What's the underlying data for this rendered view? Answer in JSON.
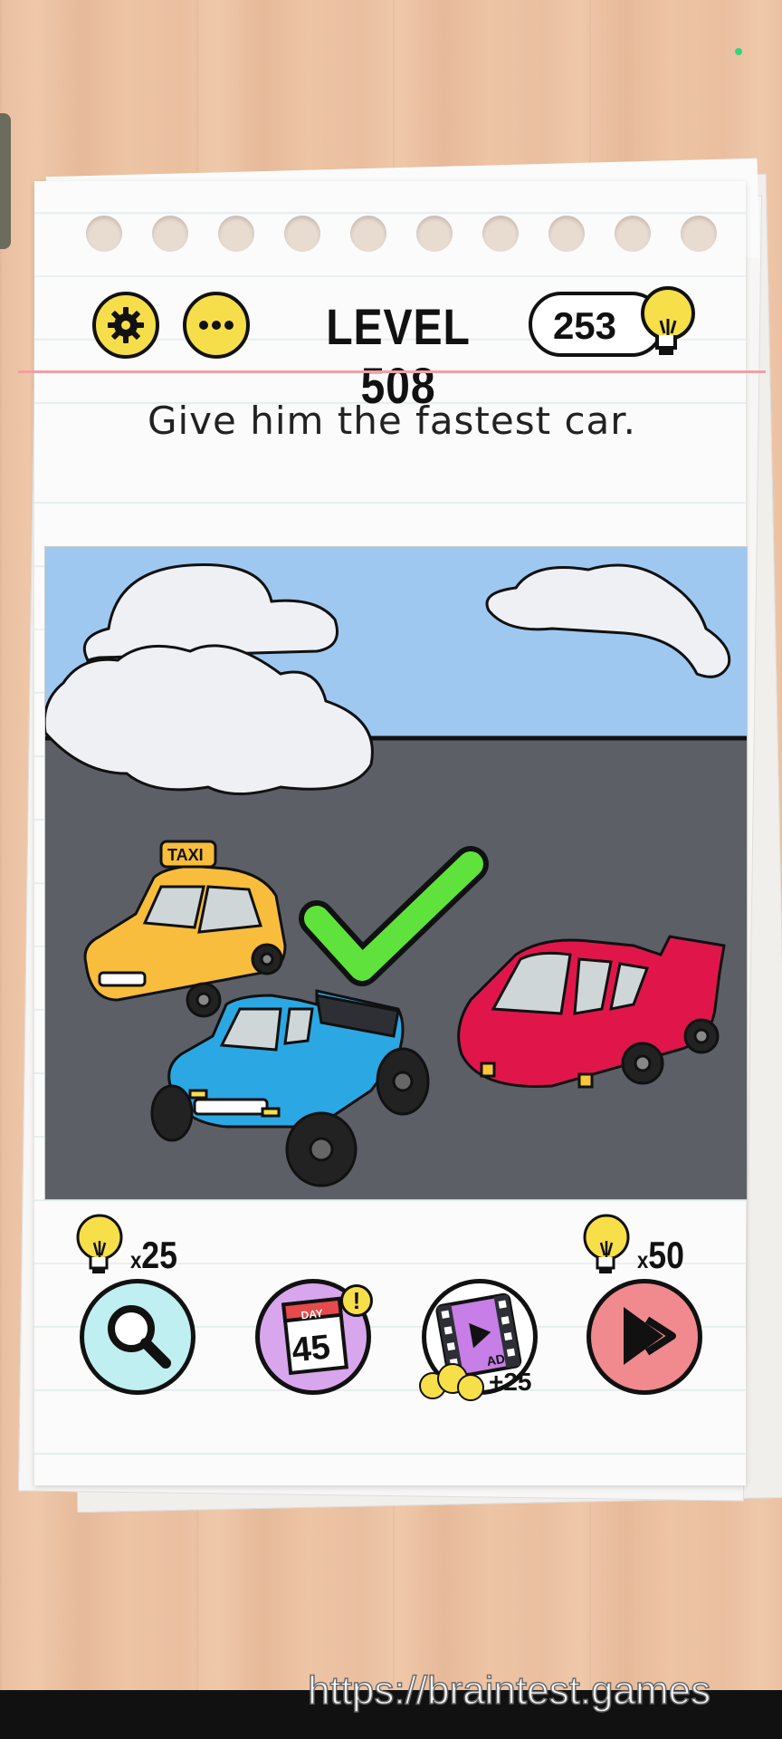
{
  "header": {
    "settings_icon": "gear-icon",
    "menu_icon": "more-dots-icon",
    "level_label": "LEVEL 508",
    "hint_count": "253",
    "hint_icon": "lightbulb-icon"
  },
  "question": "Give him the fastest car.",
  "scene": {
    "taxi_label": "TAXI",
    "cars": [
      "yellow taxi",
      "blue monster truck",
      "red sports car"
    ],
    "check_icon": "green-checkmark-icon"
  },
  "tools": {
    "magnify": {
      "cost": "25",
      "cost_prefix": "x",
      "icon": "magnifier-icon"
    },
    "daily": {
      "day_label": "DAY",
      "day_number": "45",
      "badge": "!",
      "icon": "calendar-icon"
    },
    "ad": {
      "ad_label": "AD",
      "reward": "+25",
      "icon": "film-play-icon"
    },
    "skip": {
      "cost": "50",
      "cost_prefix": "x",
      "icon": "skip-forward-icon"
    }
  },
  "colors": {
    "button_yellow": "#f6de4a",
    "sky": "#9ec8f0",
    "road": "#5c5f66",
    "check_green": "#5fe33c",
    "taxi_yellow": "#f8bd3c",
    "truck_blue": "#2ba8e4",
    "sports_red": "#e0164a"
  },
  "watermark": "https://braintest.games"
}
